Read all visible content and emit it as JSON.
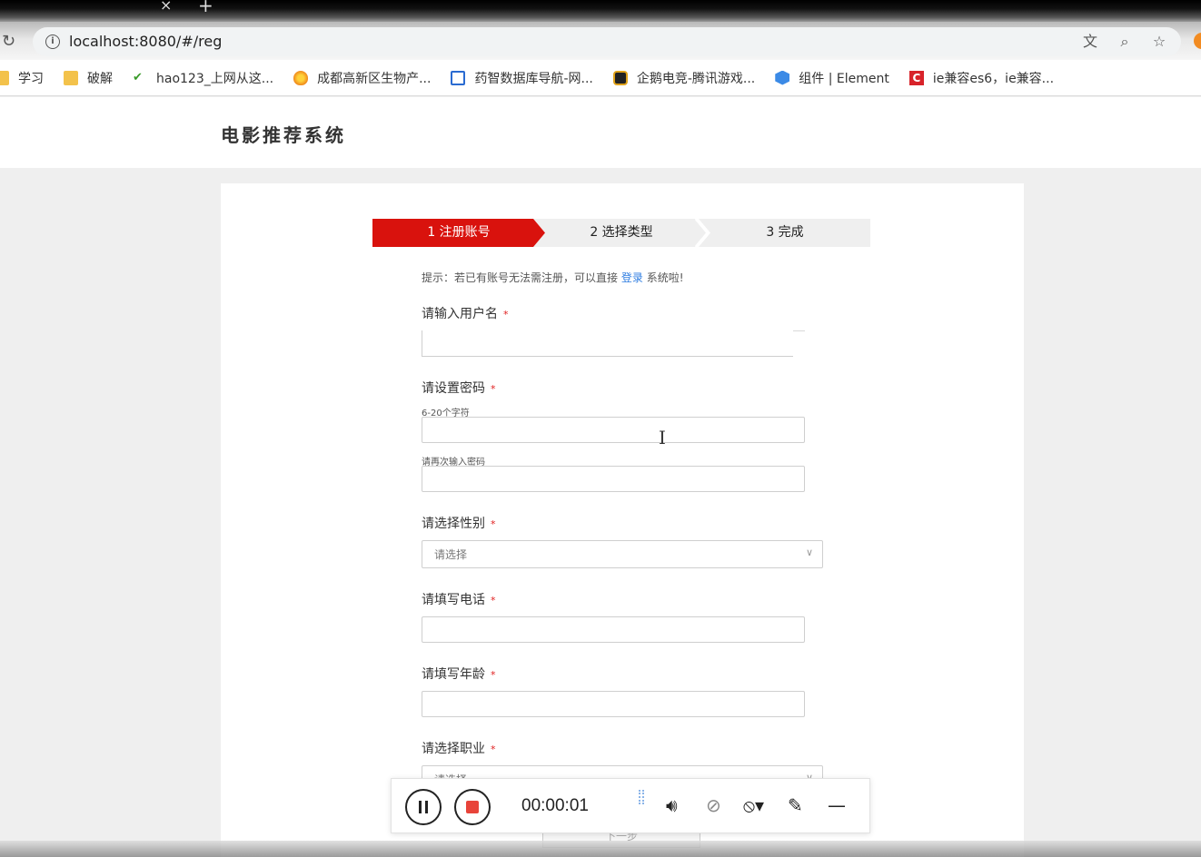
{
  "browser": {
    "tab_close": "×",
    "tab_new": "+",
    "url": "localhost:8080/#/reg",
    "bookmarks": [
      {
        "label": "学习",
        "icon": "folder-icon"
      },
      {
        "label": "破解",
        "icon": "folder-icon"
      },
      {
        "label": "hao123_上网从这...",
        "icon": "hao123-icon"
      },
      {
        "label": "成都高新区生物产...",
        "icon": "flame-icon"
      },
      {
        "label": "药智数据库导航-网...",
        "icon": "database-icon"
      },
      {
        "label": "企鹅电竞-腾讯游戏...",
        "icon": "penguin-icon"
      },
      {
        "label": "组件 | Element",
        "icon": "element-icon"
      },
      {
        "label": "ie兼容es6，ie兼容...",
        "icon": "c-logo-icon"
      }
    ]
  },
  "app": {
    "title": "电影推荐系统"
  },
  "steps": [
    "1 注册账号",
    "2 选择类型",
    "3 完成"
  ],
  "hint": {
    "prefix": "提示：若已有账号无法需注册，可以直接",
    "link": "登录",
    "suffix": "系统啦!"
  },
  "form": {
    "username_label": "请输入用户名",
    "password_label": "请设置密码",
    "password_sub": "6-20个字符",
    "password_confirm_sub": "请再次输入密码",
    "gender_label": "请选择性别",
    "gender_placeholder": "请选择",
    "phone_label": "请填写电话",
    "age_label": "请填写年龄",
    "job_label": "请选择职业",
    "job_placeholder": "请选择",
    "required_mark": "*",
    "next_label": "下一步"
  },
  "recorder": {
    "timer": "00:00:01"
  },
  "colors": {
    "step_active": "#d9120d",
    "step_inactive": "#efefef",
    "link": "#2f7de1",
    "required": "#e02020",
    "stop": "#e8443a"
  }
}
